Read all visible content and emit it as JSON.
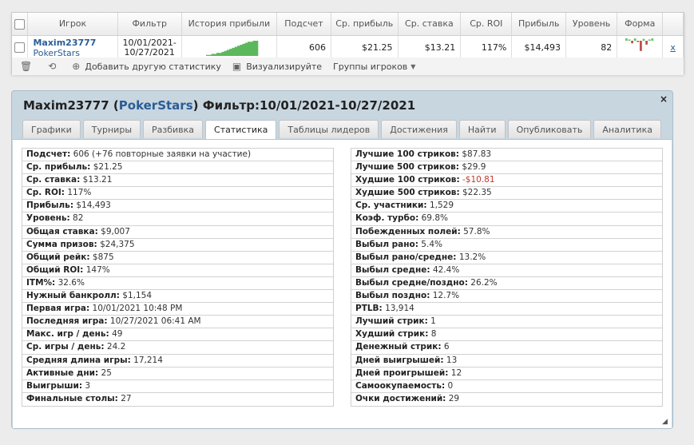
{
  "summary": {
    "headers": [
      "Игрок",
      "Фильтр",
      "История прибыли",
      "Подсчет",
      "Ср. прибыль",
      "Ср. ставка",
      "Ср. ROI",
      "Прибыль",
      "Уровень",
      "Форма"
    ],
    "row": {
      "player": "Maxim23777",
      "site": "PokerStars",
      "filter_from": "10/01/2021-",
      "filter_to": "10/27/2021",
      "count": "606",
      "avg_profit": "$21.25",
      "avg_stake": "$13.21",
      "avg_roi": "117%",
      "profit": "$14,493",
      "level": "82",
      "remove": "x"
    },
    "profit_history": [
      1,
      1,
      2,
      2,
      3,
      3,
      4,
      5,
      6,
      7,
      8,
      9,
      10,
      11,
      12,
      13,
      14,
      14,
      15,
      15
    ],
    "form_bars": [
      0.2,
      0.1,
      -0.2,
      1.0,
      -0.1,
      -0.8,
      0.15,
      -0.3,
      0.1,
      0.2
    ],
    "toolbar": {
      "add_stats": "Добавить другую статистику",
      "visualize": "Визуализируйте",
      "player_groups": "Группы игроков"
    }
  },
  "detail": {
    "title_player": "Maxim23777",
    "title_site": "PokerStars",
    "title_filter": "Фильтр:10/01/2021-10/27/2021",
    "close": "×",
    "tabs": [
      "Графики",
      "Турниры",
      "Разбивка",
      "Статистика",
      "Таблицы лидеров",
      "Достижения",
      "Найти",
      "Опубликовать",
      "Аналитика"
    ],
    "active_tab": 3,
    "left_stats": [
      {
        "label": "Подсчет:",
        "value": "606 (+76 повторные заявки на участие)"
      },
      {
        "label": "Ср. прибыль:",
        "value": "$21.25"
      },
      {
        "label": "Ср. ставка:",
        "value": "$13.21"
      },
      {
        "label": "Ср. ROI:",
        "value": "117%"
      },
      {
        "label": "Прибыль:",
        "value": "$14,493"
      },
      {
        "label": "Уровень:",
        "value": "82"
      },
      {
        "label": "Общая ставка:",
        "value": "$9,007"
      },
      {
        "label": "Сумма призов:",
        "value": "$24,375"
      },
      {
        "label": "Общий рейк:",
        "value": "$875"
      },
      {
        "label": "Общий ROI:",
        "value": "147%"
      },
      {
        "label": "ITM%:",
        "value": "32.6%"
      },
      {
        "label": "Нужный банкролл:",
        "value": "$1,154"
      },
      {
        "label": "Первая игра:",
        "value": "10/01/2021 10:48 PM"
      },
      {
        "label": "Последняя игра:",
        "value": "10/27/2021 06:41 AM"
      },
      {
        "label": "Макс. игр / день:",
        "value": "49"
      },
      {
        "label": "Ср. игры / день:",
        "value": "24.2"
      },
      {
        "label": "Средняя длина игры:",
        "value": "17,214"
      },
      {
        "label": "Активные дни:",
        "value": "25"
      },
      {
        "label": "Выигрыши:",
        "value": "3"
      },
      {
        "label": "Финальные столы:",
        "value": "27"
      }
    ],
    "right_stats": [
      {
        "label": "Лучшие 100 стриков:",
        "value": "$87.83"
      },
      {
        "label": "Лучшие 500 стриков:",
        "value": "$29.9"
      },
      {
        "label": "Худшие 100 стриков:",
        "value": "-$10.81",
        "negative": true
      },
      {
        "label": "Худшие 500 стриков:",
        "value": "$22.35"
      },
      {
        "label": "Ср. участники:",
        "value": "1,529"
      },
      {
        "label": "Коэф. турбо:",
        "value": "69.8%"
      },
      {
        "label": "Побежденных полей:",
        "value": "57.8%"
      },
      {
        "label": "Выбыл рано:",
        "value": "5.4%"
      },
      {
        "label": "Выбыл рано/средне:",
        "value": "13.2%"
      },
      {
        "label": "Выбыл средне:",
        "value": "42.4%"
      },
      {
        "label": "Выбыл средне/поздно:",
        "value": "26.2%"
      },
      {
        "label": "Выбыл поздно:",
        "value": "12.7%"
      },
      {
        "label": "PTLB:",
        "value": "13,914"
      },
      {
        "label": "Лучший стрик:",
        "value": "1"
      },
      {
        "label": "Худший стрик:",
        "value": "8"
      },
      {
        "label": "Денежный стрик:",
        "value": "6"
      },
      {
        "label": "Дней выигрышей:",
        "value": "13"
      },
      {
        "label": "Дней проигрышей:",
        "value": "12"
      },
      {
        "label": "Самоокупаемость:",
        "value": "0"
      },
      {
        "label": "Очки достижений:",
        "value": "29"
      }
    ]
  }
}
